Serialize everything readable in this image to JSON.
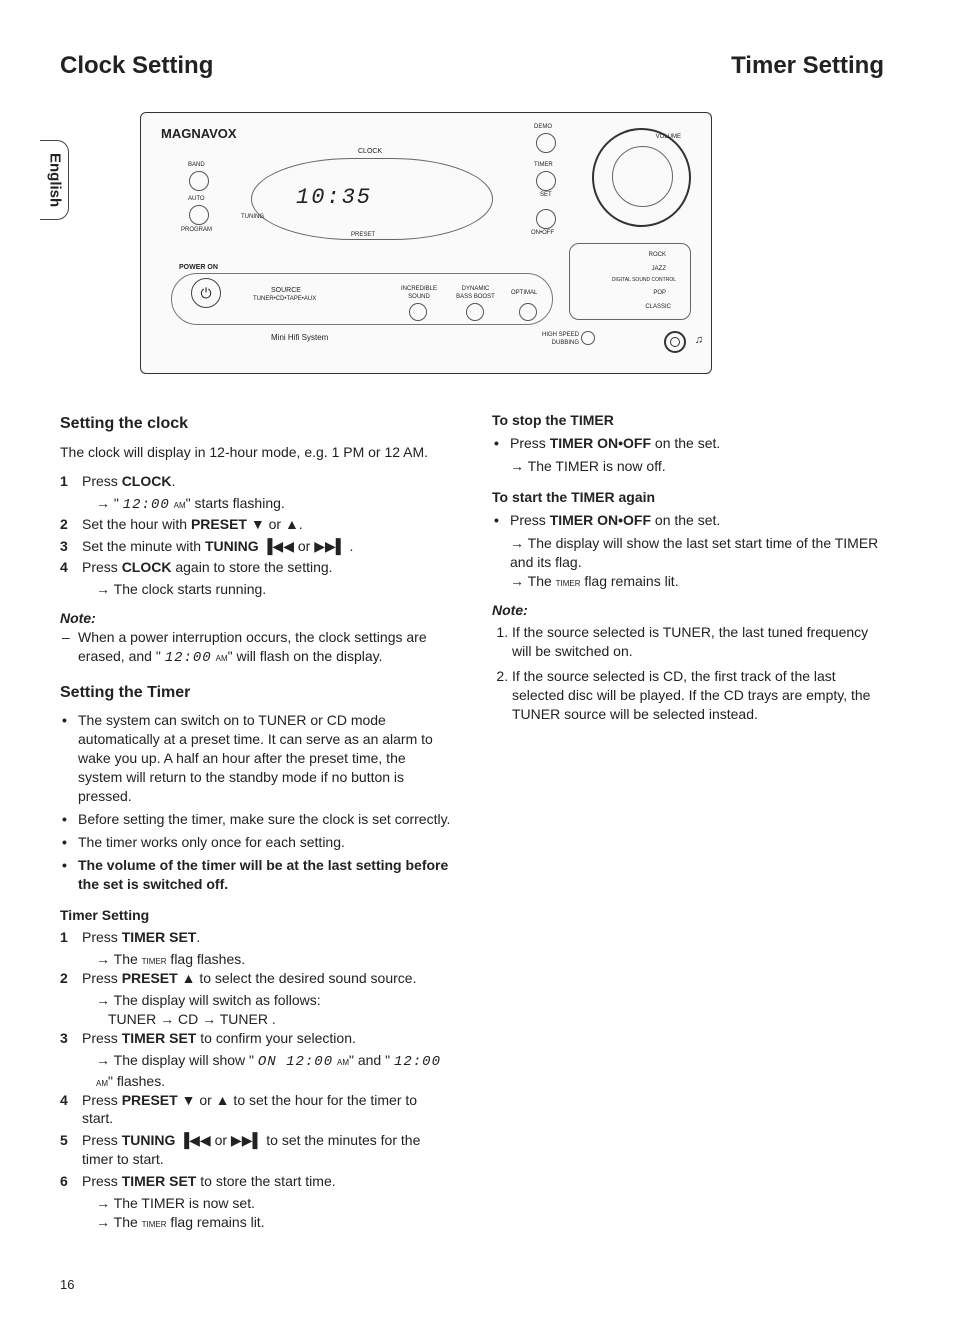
{
  "titles": {
    "left": "Clock Setting",
    "right": "Timer Setting"
  },
  "langTab": "English",
  "device": {
    "brand": "MAGNAVOX",
    "display": "10:35",
    "labels": {
      "clock": "CLOCK",
      "band": "BAND",
      "auto": "AUTO",
      "program": "PROGRAM",
      "tuning": "TUNING",
      "preset": "PRESET",
      "demo": "DEMO",
      "timer": "TIMER",
      "set": "SET",
      "onoff": "ON•OFF",
      "powerOn": "POWER ON",
      "source": "SOURCE",
      "sourceSub": "TUNER•CD•TAPE•AUX",
      "incredible": "INCREDIBLE SOUND",
      "bassBoost": "DYNAMIC BASS BOOST",
      "optimal": "OPTIMAL",
      "miniHifi": "Mini Hifi System",
      "highSpeed": "HIGH SPEED DUBBING",
      "volume": "VOLUME",
      "rock": "ROCK",
      "jazz": "JAZZ",
      "dsc": "DIGITAL SOUND CONTROL",
      "pop": "POP",
      "classic": "CLASSIC"
    }
  },
  "left": {
    "h_clock": "Setting the clock",
    "intro": "The clock will display in 12-hour mode, e.g. 1 PM or 12 AM.",
    "steps_clock": [
      {
        "n": "1",
        "t": "Press <b>CLOCK</b>."
      },
      {
        "n": "",
        "arrow": true,
        "t": "\" <span class='seg'>12:00</span> <span class='sc'>am</span>\" starts flashing."
      },
      {
        "n": "2",
        "t": "Set the hour with <b>PRESET</b> ▼ or ▲."
      },
      {
        "n": "3",
        "t": "Set the minute with <b>TUNING</b>  ▐◀◀ or ▶▶▌ ."
      },
      {
        "n": "4",
        "t": "Press <b>CLOCK</b> again to store the setting."
      },
      {
        "n": "",
        "arrow": true,
        "t": "The clock starts running."
      }
    ],
    "note1_label": "Note:",
    "note1": "When a power interruption occurs, the clock settings are erased, and \" <span class='seg'>12:00</span> <span class='sc'>am</span>\" will flash on the display.",
    "h_timer": "Setting the Timer",
    "timer_bullets": [
      "The system can switch on to TUNER or CD mode automatically at a preset time. It can serve as an alarm to wake you up. A half an hour after the preset time, the system will return to the standby mode if no button is pressed.",
      "Before setting the timer, make sure the clock is set correctly.",
      "The timer works only once for each setting.",
      "<b>The volume of the timer will be at the last setting before the set is switched off.</b>"
    ],
    "h_timerSetting": "Timer Setting",
    "steps_timer": [
      {
        "n": "1",
        "t": "Press <b>TIMER SET</b>."
      },
      {
        "n": "",
        "arrow": true,
        "t": "The <span class='sc'>timer</span> flag flashes."
      },
      {
        "n": "2",
        "t": "Press <b>PRESET</b> ▲ to select the desired sound source."
      },
      {
        "n": "",
        "arrow": true,
        "t": "The display will switch as follows:"
      },
      {
        "n": "",
        "plain": true,
        "t": "TUNER → CD → TUNER ."
      },
      {
        "n": "3",
        "t": "Press <b>TIMER SET</b> to confirm your selection."
      },
      {
        "n": "",
        "arrow": true,
        "t": "The display will show \" <span class='seg'>ON  12:00</span> <span class='sc'>am</span>\" and \" <span class='seg'>12:00</span> <span class='sc'>am</span>\" flashes."
      },
      {
        "n": "4",
        "t": "Press <b>PRESET</b> ▼ or ▲  to set the hour for the timer to start."
      },
      {
        "n": "5",
        "t": "Press <b>TUNING</b>  ▐◀◀ or ▶▶▌  to set the minutes for the timer to start."
      },
      {
        "n": "6",
        "t": "Press <b>TIMER SET</b> to store the start time."
      },
      {
        "n": "",
        "arrow": true,
        "t": "The TIMER is now set."
      },
      {
        "n": "",
        "arrow": true,
        "t": "The <span class='sc'>timer</span> flag remains lit."
      }
    ]
  },
  "right": {
    "h_stop": "To stop the TIMER",
    "stop_bullet": "Press <b>TIMER ON•OFF</b> on the set.",
    "stop_arrow": "The TIMER is now off.",
    "h_start": "To start the TIMER again",
    "start_bullet": "Press <b>TIMER ON•OFF</b> on the set.",
    "start_arrows": [
      "The display will show the last set start time of the TIMER and its flag.",
      "The <span class='sc'>timer</span> flag remains lit."
    ],
    "note_label": "Note:",
    "notes": [
      "If the source selected is TUNER, the last tuned frequency will be switched on.",
      "If the source selected is CD, the first track of the last selected disc will be played. If the CD trays are empty, the TUNER source will be selected instead."
    ]
  },
  "pageNumber": "16"
}
